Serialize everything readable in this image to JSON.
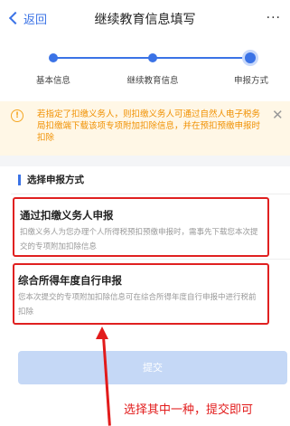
{
  "header": {
    "back_label": "返回",
    "title": "继续教育信息填写",
    "more_label": "···"
  },
  "stepper": {
    "steps": [
      "基本信息",
      "继续教育信息",
      "申报方式"
    ],
    "current_index": 2
  },
  "notice": {
    "text": "若指定了扣缴义务人，则扣缴义务人可通过自然人电子税务局扣缴端下载该项专项附加扣除信息，并在预扣预缴申报时扣除",
    "close_label": "✕"
  },
  "section": {
    "title": "选择申报方式"
  },
  "options": [
    {
      "title": "通过扣缴义务人申报",
      "description": "扣缴义务人为您办理个人所得税预扣预缴申报时，需事先下载您本次提交的专项附加扣除信息"
    },
    {
      "title": "综合所得年度自行申报",
      "description": "您本次提交的专项附加扣除信息可在综合所得年度自行申报中进行税前扣除"
    }
  ],
  "submit_label": "提交",
  "annotation": "选择其中一种，提交即可",
  "colors": {
    "accent": "#3b73e6",
    "annotation_red": "#e21b1b",
    "notice_text": "#f09000",
    "submit_disabled": "#c5d8f6"
  }
}
